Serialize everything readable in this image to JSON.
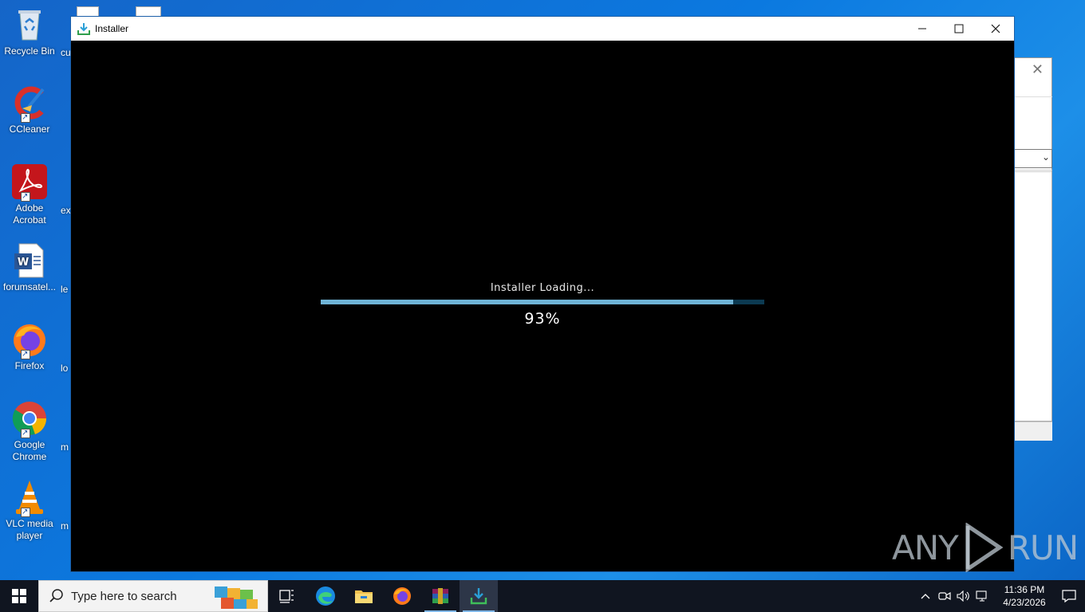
{
  "desktop": {
    "icons": [
      {
        "label": "Recycle Bin",
        "icon": "recycle-bin-icon"
      },
      {
        "label": "CCleaner",
        "icon": "ccleaner-icon"
      },
      {
        "label": "Adobe Acrobat",
        "icon": "acrobat-icon"
      },
      {
        "label": "forumsatel...",
        "icon": "word-document-icon"
      },
      {
        "label": "Firefox",
        "icon": "firefox-icon"
      },
      {
        "label": "Google Chrome",
        "icon": "chrome-icon"
      },
      {
        "label": "VLC media player",
        "icon": "vlc-icon"
      }
    ],
    "partial_labels": [
      "cu",
      "",
      "ex",
      "le",
      "lo",
      "m",
      "m"
    ]
  },
  "installer": {
    "title": "Installer",
    "status_text": "Installer Loading...",
    "progress_fraction": 0.93,
    "percent_text": "93%"
  },
  "watermark": {
    "left": "ANY",
    "right": "RUN"
  },
  "taskbar": {
    "search_placeholder": "Type here to search",
    "apps": [
      "task-view",
      "edge",
      "file-explorer",
      "firefox",
      "winrar",
      "installer"
    ],
    "clock_time": "11:36 PM",
    "clock_date": "4/23/2026"
  },
  "colors": {
    "progress_fill": "#6fb3d6",
    "progress_track": "#0c3a52",
    "taskbar": "#101520"
  }
}
